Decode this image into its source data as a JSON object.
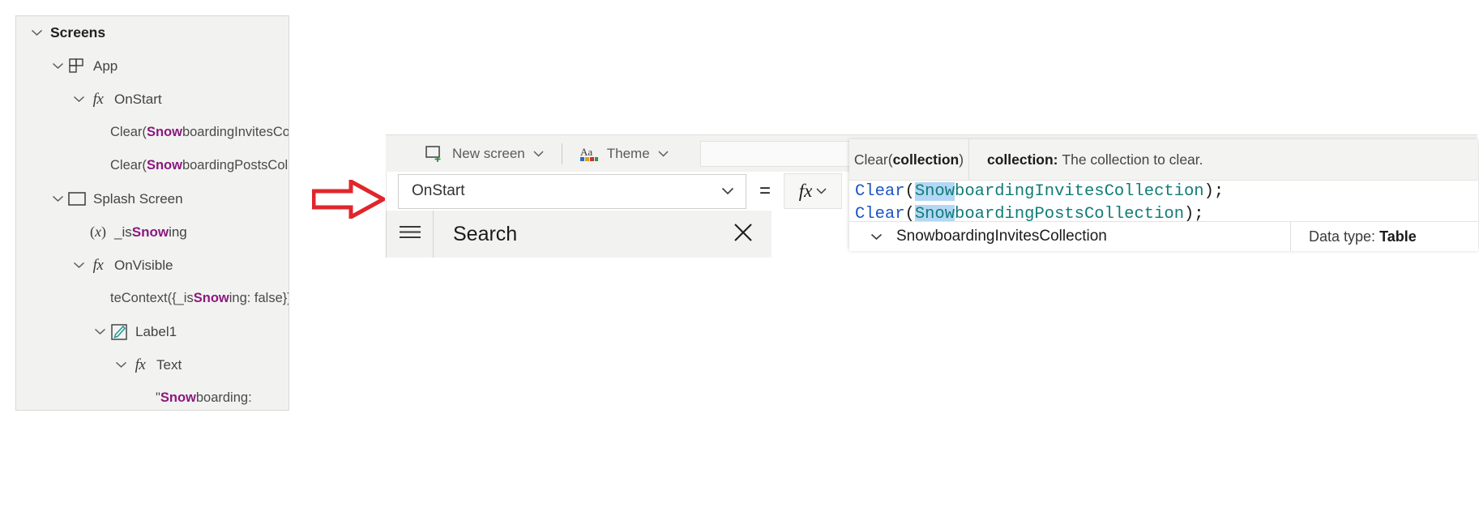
{
  "tree": {
    "rows": [
      {
        "indent": 0,
        "chevron": true,
        "icon": "none",
        "label": "Screens",
        "style": "head",
        "highlight": ""
      },
      {
        "indent": 26,
        "chevron": true,
        "icon": "app-icon",
        "label": "App",
        "style": "node",
        "highlight": ""
      },
      {
        "indent": 52,
        "chevron": true,
        "icon": "fx-icon",
        "label": "OnStart",
        "style": "node",
        "highlight": ""
      },
      {
        "indent": 78,
        "chevron": false,
        "icon": "none",
        "label": "Clear(SnowboardingInvitesColle…",
        "style": "code",
        "highlight": "Snow"
      },
      {
        "indent": 78,
        "chevron": false,
        "icon": "none",
        "label": "Clear(SnowboardingPostsCollec…",
        "style": "code",
        "highlight": "Snow"
      },
      {
        "indent": 26,
        "chevron": true,
        "icon": "screen-icon",
        "label": "Splash Screen",
        "style": "node",
        "highlight": ""
      },
      {
        "indent": 52,
        "chevron": false,
        "icon": "var-icon",
        "label": "_isSnowing",
        "style": "node",
        "highlight": "Snow"
      },
      {
        "indent": 52,
        "chevron": true,
        "icon": "fx-icon",
        "label": "OnVisible",
        "style": "node",
        "highlight": ""
      },
      {
        "indent": 78,
        "chevron": false,
        "icon": "none",
        "label": "teContext({_isSnowing: false});",
        "style": "code",
        "highlight": "Snow"
      },
      {
        "indent": 78,
        "chevron": true,
        "icon": "label-icon",
        "label": "Label1",
        "style": "node",
        "highlight": ""
      },
      {
        "indent": 104,
        "chevron": true,
        "icon": "fx-icon",
        "label": "Text",
        "style": "node",
        "highlight": ""
      },
      {
        "indent": 130,
        "chevron": false,
        "icon": "none",
        "label": "\"Snowboarding:",
        "style": "code",
        "highlight": "Snow"
      }
    ]
  },
  "arrow": {
    "name": "red-right-arrow",
    "color": "#e0262b"
  },
  "studio": {
    "commandbar": {
      "new_screen_label": "New screen",
      "new_screen_icon": "new-screen-icon",
      "theme_label": "Theme",
      "theme_icon": "theme-aa-icon",
      "caret_icon": "chevron-down-icon"
    },
    "property_row": {
      "selected_property": "OnStart",
      "dropdown_icon": "chevron-down-icon",
      "equals_sign": "=",
      "fx_label": "fx",
      "fx_caret_icon": "chevron-down-icon"
    },
    "search_row": {
      "hamburger_icon": "hamburger-menu-icon",
      "search_text": "Search",
      "clear_icon": "close-x-icon"
    }
  },
  "intellisense": {
    "tooltip": {
      "signature_prefix": "Clear(",
      "signature_param": "collection",
      "signature_suffix": ")",
      "desc_param": "collection:",
      "desc_text": "The collection to clear."
    },
    "code": {
      "line1_fn": "Clear",
      "line1_open": "(",
      "line1_selected": "Snow",
      "line1_rest": "boardingInvitesCollection",
      "line1_close": ");",
      "line2_fn": "Clear",
      "line2_open": "(",
      "line2_selected": "Snow",
      "line2_rest": "boardingPostsCollection",
      "line2_close": ");"
    },
    "suggestion": {
      "expand_icon": "chevron-down-icon",
      "name": "SnowboardingInvitesCollection",
      "type_label": "Data type:",
      "type_value": "Table"
    }
  },
  "colors": {
    "highlight_purple": "#8c197f",
    "code_function_blue": "#1a56c4",
    "code_identifier_teal": "#107c77",
    "selection_blue": "#b3d7f5",
    "arrow_red": "#e0262b",
    "panel_gray": "#f2f2f1"
  }
}
